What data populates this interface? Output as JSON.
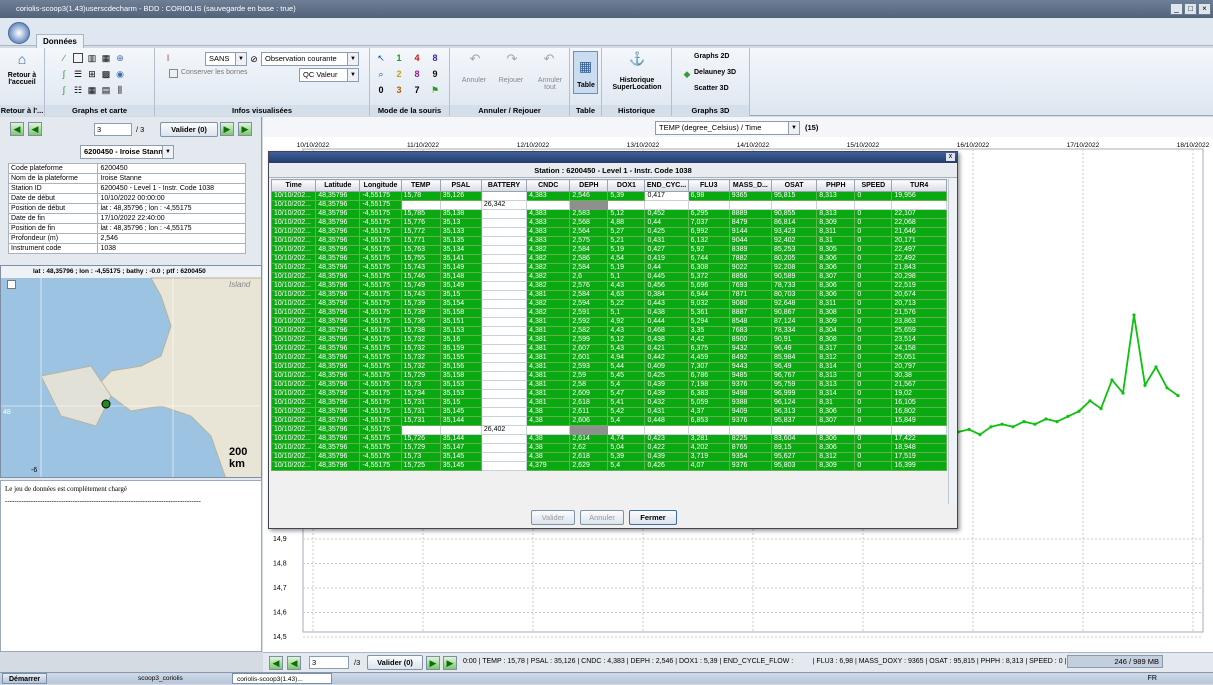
{
  "window": {
    "title": "coriolis-scoop3(1.43)userscdecharm - BDD : CORIOLIS (sauvegarde en base : true)"
  },
  "ribbon": {
    "tab": "Données",
    "home": {
      "label": "Retour à l'accueil",
      "group": "Retour à l'..."
    },
    "graphs_group": "Graphs et carte",
    "conserve_label": "Conserver les bornes",
    "info": {
      "font_value": "SANS",
      "obs_value": "Observation courante",
      "qc_value": "QC Valeur",
      "group": "Infos visualisées"
    },
    "mouse_group": "Mode de la souris",
    "mouse_digits": [
      "1",
      "4",
      "8",
      "2",
      "8",
      "9",
      "0",
      "3",
      "7"
    ],
    "undo": {
      "undo": "Annuler",
      "redo": "Rejouer",
      "undo_all": "Annuler tout",
      "group": "Annuler / Rejouer"
    },
    "table": {
      "label": "Table",
      "group": "Table"
    },
    "history": {
      "label": "Historique SuperLocation",
      "group": "Historique"
    },
    "graphs3d": {
      "graphs2d": "Graphs 2D",
      "delaunay": "Delauney 3D",
      "scatter": "Scatter 3D",
      "group": "Graphs 3D"
    }
  },
  "left": {
    "page_current": "3",
    "page_total": "/ 3",
    "validate_label": "Valider (0)",
    "platform_select": "6200450 - Iroise Stanne",
    "info_rows": [
      {
        "label": "Code plateforme",
        "value": "6200450"
      },
      {
        "label": "Nom de la plateforme",
        "value": "Iroise Stanne"
      },
      {
        "label": "Station ID",
        "value": "6200450 - Level 1 - Instr. Code 1038"
      },
      {
        "label": "Date de début",
        "value": "10/10/2022 00:00:00"
      },
      {
        "label": "Position de début",
        "value": "lat : 48,35796 ; lon : -4,55175"
      },
      {
        "label": "Date de fin",
        "value": "17/10/2022 22:40:00"
      },
      {
        "label": "Position de fin",
        "value": "lat : 48,35796 ; lon : -4,55175"
      },
      {
        "label": "Profondeur (m)",
        "value": "2,546"
      },
      {
        "label": "Instrument code",
        "value": "1038"
      }
    ],
    "map_header": "lat : 48,35796 ; lon : -4,55175 ; bathy : -0.0 ; ptf : 6200450",
    "map_place": "Island",
    "map_lat": "48",
    "map_lon": "-6",
    "map_scale": "200 km",
    "message": "Le jeu de données est complètement chargé",
    "message_line": "------------------------------------------------------------------------------------"
  },
  "chart": {
    "variable_select": "TEMP (degree_Celsius) / Time",
    "count": "(15)",
    "dates": [
      "10/10/2022",
      "11/10/2022",
      "12/10/2022",
      "13/10/2022",
      "14/10/2022",
      "15/10/2022",
      "16/10/2022",
      "17/10/2022",
      "18/10/2022"
    ],
    "y_ticks": [
      "14,9",
      "14,8",
      "14,7",
      "14,6",
      "14,5"
    ]
  },
  "chart_data": {
    "type": "line",
    "xlabel": "Time",
    "ylabel": "TEMP (degree_Celsius)",
    "series": [
      {
        "values": [
          15.1,
          15.11,
          15.09,
          15.12,
          15.13,
          15.12,
          15.14,
          15.13,
          15.15,
          15.14,
          15.16,
          15.18,
          15.22,
          15.19,
          15.3,
          15.25,
          15.55,
          15.28,
          15.35,
          15.27,
          15.24
        ]
      }
    ]
  },
  "dialog": {
    "caption": "Station : 6200450 - Level 1 - Instr. Code 1038",
    "columns": [
      "Time",
      "Latitude",
      "Longitude",
      "TEMP",
      "PSAL",
      "BATTERY",
      "CNDC",
      "DEPH",
      "DOX1",
      "END_CYC...",
      "FLU3",
      "MASS_D...",
      "OSAT",
      "PHPH",
      "SPEED",
      "TUR4"
    ],
    "rows": [
      [
        "10/10/202...",
        "48,35796",
        "-4,55175",
        "15,78",
        "35,126",
        "",
        "4,383",
        "2,546",
        "5,39",
        "0,417",
        "6,98",
        "9365",
        "95,815",
        "8,313",
        "0",
        "19,956"
      ],
      [
        "10/10/202...",
        "48,35796",
        "-4,55175",
        "",
        "",
        "26,342",
        "",
        "",
        "",
        "",
        "",
        "",
        "",
        "",
        "",
        ""
      ],
      [
        "10/10/202...",
        "48,35796",
        "-4,55175",
        "15,785",
        "35,138",
        "",
        "4,383",
        "2,583",
        "5,12",
        "0,452",
        "6,295",
        "8889",
        "90,855",
        "8,313",
        "0",
        "22,107"
      ],
      [
        "10/10/202...",
        "48,35796",
        "-4,55175",
        "15,776",
        "35,13",
        "",
        "4,383",
        "2,568",
        "4,88",
        "0,44",
        "7,037",
        "8479",
        "86,814",
        "8,309",
        "0",
        "22,068"
      ],
      [
        "10/10/202...",
        "48,35796",
        "-4,55175",
        "15,772",
        "35,133",
        "",
        "4,383",
        "2,564",
        "5,27",
        "0,425",
        "6,992",
        "9144",
        "93,423",
        "8,311",
        "0",
        "21,646"
      ],
      [
        "10/10/202...",
        "48,35796",
        "-4,55175",
        "15,771",
        "35,135",
        "",
        "4,383",
        "2,575",
        "5,21",
        "0,431",
        "6,132",
        "9044",
        "92,402",
        "8,31",
        "0",
        "20,171"
      ],
      [
        "10/10/202...",
        "48,35796",
        "-4,55175",
        "15,763",
        "35,134",
        "",
        "4,382",
        "2,584",
        "5,19",
        "0,427",
        "5,92",
        "8389",
        "85,253",
        "8,305",
        "0",
        "22,497"
      ],
      [
        "10/10/202...",
        "48,35796",
        "-4,55175",
        "15,755",
        "35,141",
        "",
        "4,382",
        "2,586",
        "4,54",
        "0,419",
        "6,744",
        "7882",
        "80,205",
        "8,306",
        "0",
        "22,492"
      ],
      [
        "10/10/202...",
        "48,35796",
        "-4,55175",
        "15,743",
        "35,149",
        "",
        "4,382",
        "2,584",
        "5,19",
        "0,44",
        "6,308",
        "9022",
        "92,208",
        "8,306",
        "0",
        "21,843"
      ],
      [
        "10/10/202...",
        "48,35796",
        "-4,55175",
        "15,746",
        "35,148",
        "",
        "4,382",
        "2,6",
        "5,1",
        "0,445",
        "5,372",
        "8856",
        "90,589",
        "8,307",
        "0",
        "20,298"
      ],
      [
        "10/10/202...",
        "48,35796",
        "-4,55175",
        "15,749",
        "35,149",
        "",
        "4,382",
        "2,576",
        "4,43",
        "0,456",
        "5,696",
        "7693",
        "78,733",
        "8,306",
        "0",
        "22,519"
      ],
      [
        "10/10/202...",
        "48,35796",
        "-4,55175",
        "15,743",
        "35,15",
        "",
        "4,381",
        "2,584",
        "4,63",
        "0,384",
        "6,944",
        "7871",
        "80,703",
        "8,306",
        "0",
        "20,674"
      ],
      [
        "10/10/202...",
        "48,35796",
        "-4,55175",
        "15,739",
        "35,154",
        "",
        "4,382",
        "2,594",
        "5,22",
        "0,443",
        "9,032",
        "9080",
        "92,648",
        "8,311",
        "0",
        "20,713"
      ],
      [
        "10/10/202...",
        "48,35796",
        "-4,55175",
        "15,739",
        "35,158",
        "",
        "4,382",
        "2,591",
        "5,1",
        "0,438",
        "5,361",
        "8887",
        "90,867",
        "8,308",
        "0",
        "21,576"
      ],
      [
        "10/10/202...",
        "48,35796",
        "-4,55175",
        "15,736",
        "35,151",
        "",
        "4,381",
        "2,592",
        "4,92",
        "0,444",
        "5,294",
        "8548",
        "87,124",
        "8,309",
        "0",
        "23,863"
      ],
      [
        "10/10/202...",
        "48,35796",
        "-4,55175",
        "15,738",
        "35,153",
        "",
        "4,381",
        "2,582",
        "4,43",
        "0,468",
        "3,35",
        "7683",
        "78,334",
        "8,304",
        "0",
        "25,659"
      ],
      [
        "10/10/202...",
        "48,35796",
        "-4,55175",
        "15,732",
        "35,16",
        "",
        "4,381",
        "2,599",
        "5,12",
        "0,438",
        "4,42",
        "8900",
        "90,91",
        "8,308",
        "0",
        "23,514"
      ],
      [
        "10/10/202...",
        "48,35796",
        "-4,55175",
        "15,732",
        "35,159",
        "",
        "4,381",
        "2,607",
        "5,43",
        "0,421",
        "6,375",
        "9432",
        "96,49",
        "8,317",
        "0",
        "24,158"
      ],
      [
        "10/10/202...",
        "48,35796",
        "-4,55175",
        "15,732",
        "35,155",
        "",
        "4,381",
        "2,601",
        "4,94",
        "0,442",
        "4,459",
        "8492",
        "85,984",
        "8,312",
        "0",
        "25,051"
      ],
      [
        "10/10/202...",
        "48,35796",
        "-4,55175",
        "15,732",
        "35,156",
        "",
        "4,381",
        "2,593",
        "5,44",
        "0,409",
        "7,307",
        "9443",
        "96,49",
        "8,314",
        "0",
        "20,797"
      ],
      [
        "10/10/202...",
        "48,35796",
        "-4,55175",
        "15,729",
        "35,158",
        "",
        "4,381",
        "2,59",
        "5,45",
        "0,425",
        "6,786",
        "9485",
        "96,767",
        "8,313",
        "0",
        "30,38"
      ],
      [
        "10/10/202...",
        "48,35796",
        "-4,55175",
        "15,73",
        "35,153",
        "",
        "4,381",
        "2,58",
        "5,4",
        "0,439",
        "7,198",
        "9376",
        "95,759",
        "8,313",
        "0",
        "21,567"
      ],
      [
        "10/10/202...",
        "48,35796",
        "-4,55175",
        "15,734",
        "35,153",
        "",
        "4,381",
        "2,609",
        "5,47",
        "0,439",
        "6,383",
        "9498",
        "96,999",
        "8,314",
        "0",
        "19,02"
      ],
      [
        "10/10/202...",
        "48,35796",
        "-4,55175",
        "15,731",
        "35,15",
        "",
        "4,381",
        "2,618",
        "5,41",
        "0,432",
        "5,059",
        "9388",
        "96,124",
        "8,31",
        "0",
        "16,105"
      ],
      [
        "10/10/202...",
        "48,35796",
        "-4,55175",
        "15,731",
        "35,145",
        "",
        "4,38",
        "2,611",
        "5,42",
        "0,431",
        "4,37",
        "9409",
        "96,313",
        "8,306",
        "0",
        "16,802"
      ],
      [
        "10/10/202...",
        "48,35796",
        "-4,55175",
        "15,731",
        "35,144",
        "",
        "4,38",
        "2,606",
        "5,4",
        "0,448",
        "6,853",
        "9376",
        "95,837",
        "8,307",
        "0",
        "15,849"
      ],
      [
        "10/10/202...",
        "48,35796",
        "-4,55175",
        "",
        "",
        "26,402",
        "",
        "",
        "",
        "",
        "",
        "",
        "",
        "",
        "",
        ""
      ],
      [
        "10/10/202...",
        "48,35796",
        "-4,55175",
        "15,726",
        "35,144",
        "",
        "4,38",
        "2,614",
        "4,74",
        "0,423",
        "3,281",
        "8225",
        "83,604",
        "8,306",
        "0",
        "17,422"
      ],
      [
        "10/10/202...",
        "48,35796",
        "-4,55175",
        "15,729",
        "35,147",
        "",
        "4,38",
        "2,62",
        "5,04",
        "0,422",
        "4,202",
        "8765",
        "89,15",
        "8,306",
        "0",
        "18,948"
      ],
      [
        "10/10/202...",
        "48,35796",
        "-4,55175",
        "15,73",
        "35,145",
        "",
        "4,38",
        "2,618",
        "5,39",
        "0,439",
        "3,719",
        "9354",
        "95,627",
        "8,312",
        "0",
        "17,519"
      ],
      [
        "10/10/202...",
        "48,35796",
        "-4,55175",
        "15,725",
        "35,145",
        "",
        "4,379",
        "2,629",
        "5,4",
        "0,426",
        "4,07",
        "9376",
        "95,803",
        "8,309",
        "0",
        "16,399"
      ]
    ],
    "buttons": {
      "valider": "Valider",
      "annuler": "Annuler",
      "fermer": "Fermer"
    },
    "close": "x"
  },
  "status": {
    "page_current": "3",
    "page_total": "/3",
    "validate_label": "Valider (0)",
    "text": "0:00 | TEMP : 15,78 | PSAL : 35,126 | CNDC : 4,383 | DEPH : 2,546 | DOX1 : 5,39 | END_CYCLE_FLOW :          | FLU3 : 6,98 | MASS_DOXY : 9365 | OSAT : 95,815 | PHPH : 8,313 | SPEED : 0 | TUR4",
    "memory": "246 / 989 MB"
  },
  "taskbar": {
    "start": "Démarrer",
    "task1": "scoop3_coriolis",
    "task2": "coriolis-scoop3(1.43)...",
    "lang": "FR"
  },
  "colors": {
    "accent_green": "#0ba911",
    "title_blue": "#233c6c"
  }
}
